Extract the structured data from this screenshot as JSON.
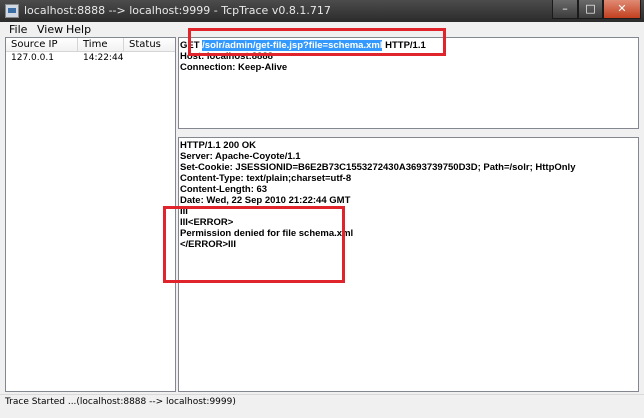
{
  "titlebar": {
    "title": "localhost:8888 --> localhost:9999 - TcpTrace v0.8.1.717",
    "minimize_glyph": "–",
    "maximize_glyph": "□",
    "close_glyph": "✕"
  },
  "menu": {
    "items": [
      {
        "label": "File"
      },
      {
        "label": "View"
      },
      {
        "label": "Help"
      }
    ]
  },
  "connections": {
    "columns": [
      {
        "label": "Source IP"
      },
      {
        "label": "Time"
      },
      {
        "label": "Status"
      }
    ],
    "rows": [
      {
        "source_ip": "127.0.0.1",
        "time": "14:22:44",
        "status": ""
      }
    ]
  },
  "request": {
    "lines": [
      {
        "before": "GET ",
        "selected": "/solr/admin/get-file.jsp?file=schema.xml",
        "after": " HTTP/1.1"
      },
      {
        "text": "Host: localhost:8888"
      },
      {
        "text": "Connection: Keep-Alive"
      }
    ]
  },
  "response": {
    "lines": [
      "HTTP/1.1 200 OK",
      "Server: Apache-Coyote/1.1",
      "Set-Cookie: JSESSIONID=B6E2B73C1553272430A3693739750D3D; Path=/solr; HttpOnly",
      "Content-Type: text/plain;charset=utf-8",
      "Content-Length: 63",
      "Date: Wed, 22 Sep 2010 21:22:44 GMT",
      "III",
      "III<ERROR>",
      "Permission denied for file schema.xml",
      "</ERROR>III"
    ]
  },
  "status": {
    "text": "Trace Started ...(localhost:8888 --> localhost:9999)"
  },
  "colors": {
    "annotation": "#e0242b",
    "selection": "#3399ff",
    "titlebar": "#2b2b2b"
  },
  "icons": {
    "app": "app-icon"
  }
}
